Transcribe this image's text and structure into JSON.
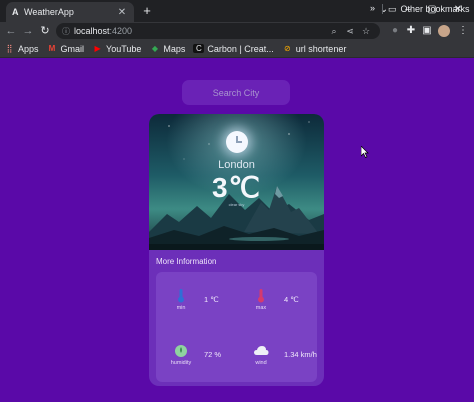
{
  "browser": {
    "tab_title": "WeatherApp",
    "url_host": "localhost",
    "url_port": ":4200",
    "bookmarks": [
      {
        "label": "Apps",
        "icon": "apps-grid-icon"
      },
      {
        "label": "Gmail",
        "icon": "gmail-icon"
      },
      {
        "label": "YouTube",
        "icon": "youtube-icon"
      },
      {
        "label": "Maps",
        "icon": "maps-icon"
      },
      {
        "label": "Carbon | Creat...",
        "icon": "carbon-icon"
      },
      {
        "label": "url shortener",
        "icon": "url-shortener-icon"
      }
    ],
    "other_bookmarks": "Other bookmarks"
  },
  "search": {
    "placeholder": "Search City"
  },
  "weather": {
    "city": "London",
    "temperature": "3℃",
    "description": "clear sky"
  },
  "more_info": {
    "title": "More Information",
    "stats": [
      {
        "label": "min",
        "value": "1 ℃",
        "icon": "thermometer-low-icon"
      },
      {
        "label": "max",
        "value": "4 ℃",
        "icon": "thermometer-high-icon"
      },
      {
        "label": "humidity",
        "value": "72 %",
        "icon": "humidity-icon"
      },
      {
        "label": "wind",
        "value": "1.34 km/h",
        "icon": "wind-cloud-icon"
      }
    ]
  },
  "colors": {
    "page_bg": "#5a09a8",
    "card_bg": "#6c2fb9",
    "panel_bg": "#7a42c4"
  }
}
